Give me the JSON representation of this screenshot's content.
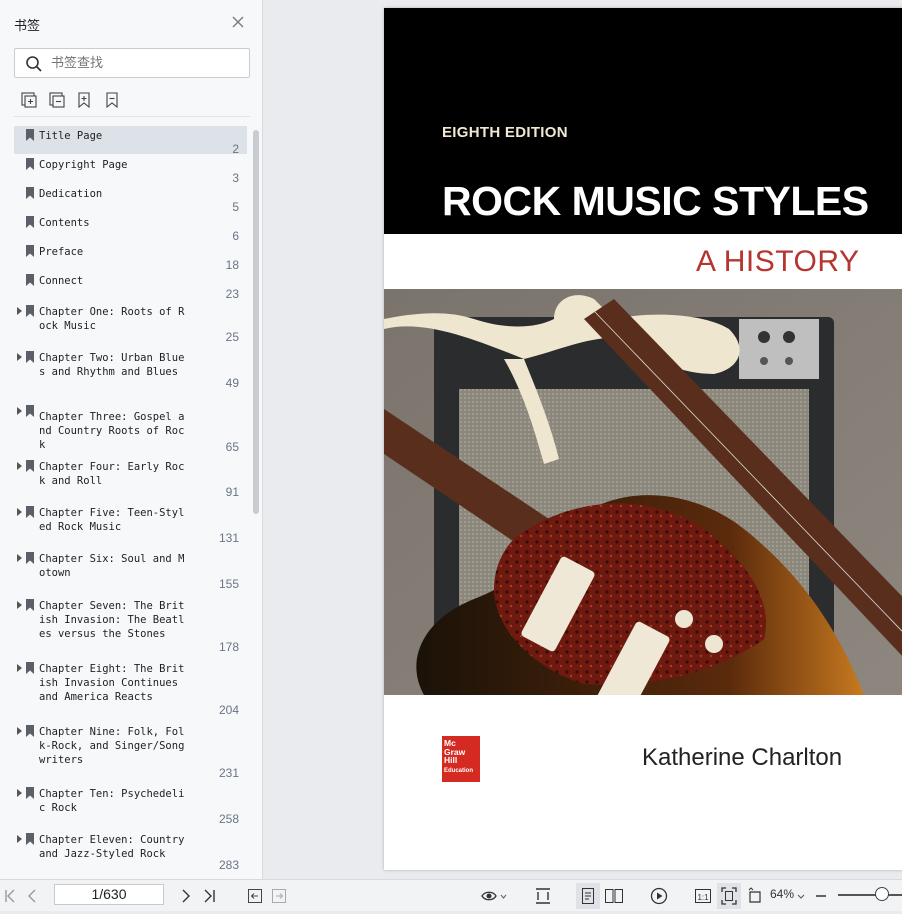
{
  "sidebar": {
    "title": "书签",
    "search_placeholder": "书签查找",
    "items": [
      {
        "label": "Title Page",
        "page": "2",
        "expandable": false,
        "selected": true
      },
      {
        "label": "Copyright Page",
        "page": "3",
        "expandable": false
      },
      {
        "label": "Dedication",
        "page": "5",
        "expandable": false
      },
      {
        "label": "Contents",
        "page": "6",
        "expandable": false
      },
      {
        "label": "Preface",
        "page": "18",
        "expandable": false
      },
      {
        "label": "Connect",
        "page": "23",
        "expandable": false
      },
      {
        "label": "Chapter One: Roots of Rock Music",
        "page": "25",
        "expandable": true
      },
      {
        "label": "Chapter Two: Urban Blues and Rhythm and Blues",
        "page": "49",
        "expandable": true
      },
      {
        "label": "Chapter Three: Gospel and Country Roots of Rock",
        "page": "65",
        "expandable": true
      },
      {
        "label": "Chapter Four: Early Rock and Roll",
        "page": "91",
        "expandable": true
      },
      {
        "label": "Chapter Five: Teen-Styled Rock Music",
        "page": "131",
        "expandable": true
      },
      {
        "label": "Chapter Six: Soul and Motown",
        "page": "155",
        "expandable": true
      },
      {
        "label": "Chapter Seven: The British Invasion: The Beatles versus the Stones",
        "page": "178",
        "expandable": true
      },
      {
        "label": "Chapter Eight: The British Invasion Continues and America Reacts",
        "page": "204",
        "expandable": true
      },
      {
        "label": "Chapter Nine: Folk, Folk-Rock, and Singer/Songwriters",
        "page": "231",
        "expandable": true
      },
      {
        "label": "Chapter Ten: Psychedelic Rock",
        "page": "258",
        "expandable": true
      },
      {
        "label": "Chapter Eleven: Country and Jazz-Styled Rock",
        "page": "283",
        "expandable": true
      }
    ]
  },
  "cover": {
    "edition": "EIGHTH EDITION",
    "title": "ROCK MUSIC STYLES",
    "subtitle": "A HISTORY",
    "publisher_logo": "Mc Graw Hill Education",
    "author": "Katherine Charlton"
  },
  "statusbar": {
    "page_indicator": "1/630",
    "zoom": "64%"
  },
  "icons": {
    "close": "close-icon",
    "search": "search-icon",
    "bookmark": "bookmark-icon"
  },
  "colors": {
    "selected_row": "#dde1e8",
    "subtitle_red": "#b5352f",
    "logo_red": "#d42a22"
  }
}
